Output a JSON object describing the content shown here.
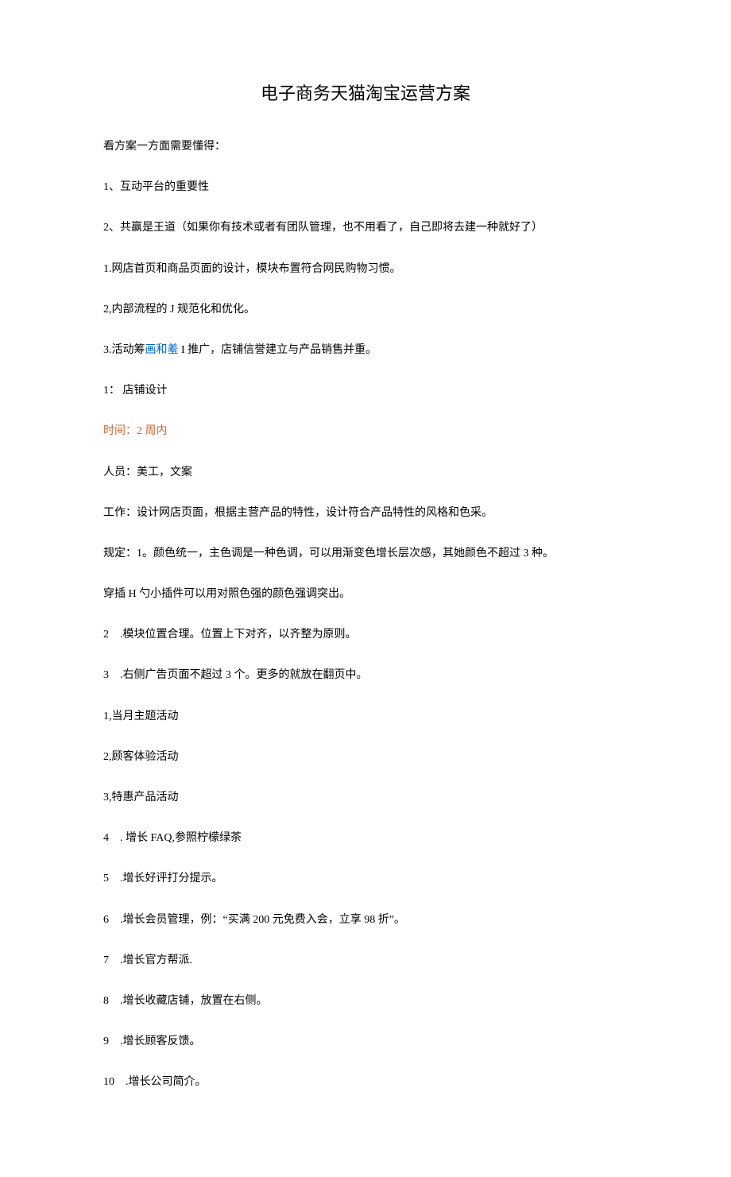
{
  "title": "电子商务天猫淘宝运营方案",
  "lines": {
    "l1": "看方案一方面需要懂得：",
    "l2": "1、互动平台的重要性",
    "l3": "2、共赢是王道（如果你有技术或者有团队管理，也不用看了，自己即将去建一种就好了）",
    "l4": "1.网店首页和商品页面的设计，模块布置符合网民购物习惯。",
    "l5": "2,内部流程的 J 规范化和优化。",
    "l6a": "3.活动筹",
    "l6b": "画和羞",
    "l6c": " I 推广，店铺信誉建立与产品销售并重。",
    "l7": "1： 店铺设计",
    "l8a": "时间：",
    "l8b": "2",
    "l8c": " 周内",
    "l9": "人员：美工，文案",
    "l10": "工作：设计网店页面，根据主营产品的特性，设计符合产品特性的风格和色采。",
    "l11": "规定：1。颜色统一，主色调是一种色调，可以用渐变色增长层次感，其她颜色不超过 3 种。",
    "l12": "穿插 H 勺小插件可以用对照色强的颜色强调突出。",
    "l13": "2　.模块位置合理。位置上下对齐，以齐整为原则。",
    "l14": "3　.右侧广告页面不超过 3 个。更多的就放在翻页中。",
    "l15": "1,当月主题活动",
    "l16": "2,顾客体验活动",
    "l17": "3,特惠产品活动",
    "l18": "4　. 增长 FAQ,参照柠檬绿茶",
    "l19": "5　.增长好评打分提示。",
    "l20": "6　.增长会员管理，例：“买满 200 元免费入会，立享 98 折”。",
    "l21": "7　.增长官方帮派.",
    "l22": "8　.增长收藏店铺，放置在右侧。",
    "l23": "9　.增长顾客反馈。",
    "l24": "10　.增长公司简介。"
  }
}
